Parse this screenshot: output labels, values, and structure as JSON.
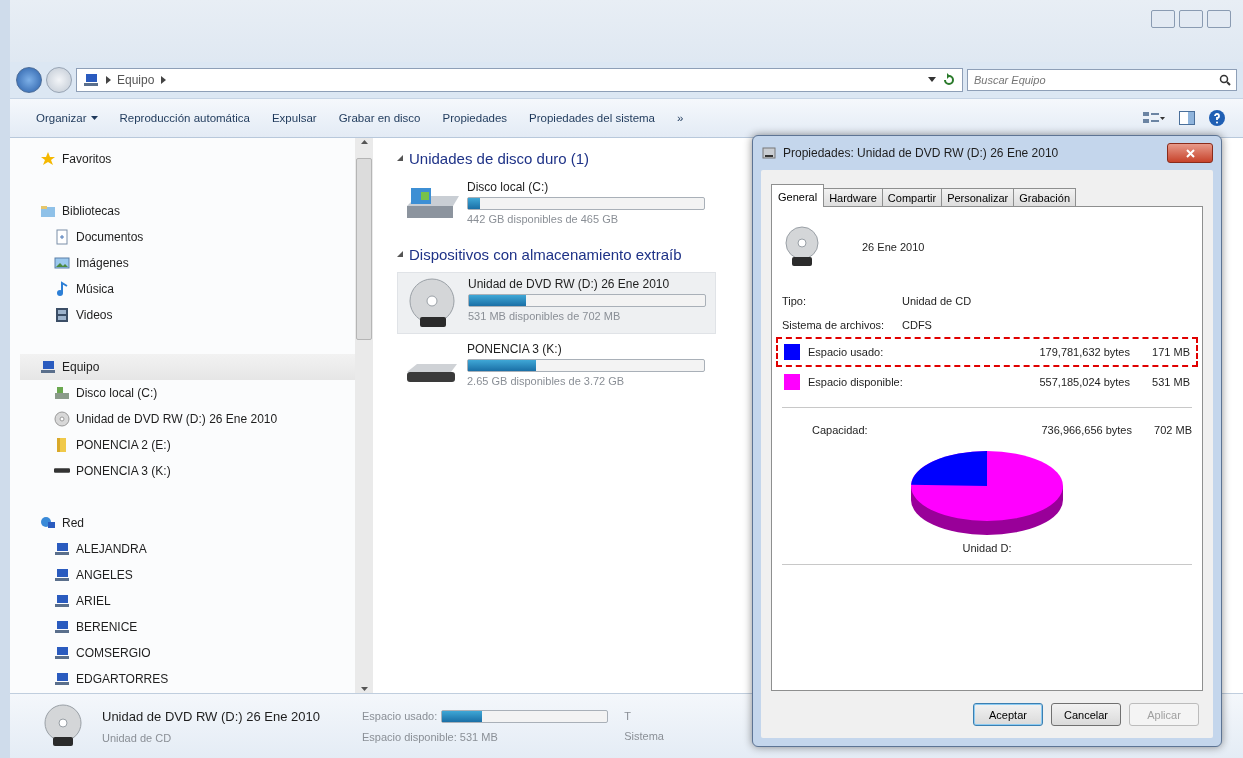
{
  "address_bar": {
    "breadcrumbs": [
      "Equipo"
    ]
  },
  "search": {
    "placeholder": "Buscar Equipo"
  },
  "toolbar": {
    "items": [
      {
        "label": "Organizar",
        "kind": "menu"
      },
      {
        "label": "Reproducción automática",
        "kind": "command"
      },
      {
        "label": "Expulsar",
        "kind": "command"
      },
      {
        "label": "Grabar en disco",
        "kind": "command"
      },
      {
        "label": "Propiedades",
        "kind": "command"
      },
      {
        "label": "Propiedades del sistema",
        "kind": "command"
      }
    ],
    "overflow": "»"
  },
  "sidebar": {
    "sections": [
      {
        "label": "Favoritos",
        "kind": "favorites",
        "selected": false
      },
      {
        "label": "Bibliotecas",
        "kind": "libraries",
        "selected": false,
        "children": [
          {
            "label": "Documentos",
            "kind": "documents",
            "selected": false
          },
          {
            "label": "Imágenes",
            "kind": "pictures",
            "selected": false
          },
          {
            "label": "Música",
            "kind": "music",
            "selected": false
          },
          {
            "label": "Videos",
            "kind": "videos",
            "selected": false
          }
        ]
      },
      {
        "label": "Equipo",
        "kind": "computer",
        "selected": true,
        "children": [
          {
            "label": "Disco local (C:)",
            "kind": "disk",
            "selected": false
          },
          {
            "label": "Unidad de DVD RW (D:) 26 Ene 2010",
            "kind": "dvd",
            "selected": false
          },
          {
            "label": "PONENCIA 2 (E:)",
            "kind": "folder",
            "selected": false
          },
          {
            "label": "PONENCIA 3 (K:)",
            "kind": "usb",
            "selected": false
          }
        ]
      },
      {
        "label": "Red",
        "kind": "network",
        "selected": false,
        "children": [
          {
            "label": "ALEJANDRA",
            "kind": "pc",
            "selected": false
          },
          {
            "label": "ANGELES",
            "kind": "pc",
            "selected": false
          },
          {
            "label": "ARIEL",
            "kind": "pc",
            "selected": false
          },
          {
            "label": "BERENICE",
            "kind": "pc",
            "selected": false
          },
          {
            "label": "COMSERGIO",
            "kind": "pc",
            "selected": false
          },
          {
            "label": "EDGARTORRES",
            "kind": "pc",
            "selected": false
          }
        ]
      }
    ]
  },
  "content": {
    "groups": [
      {
        "title": "Unidades de disco duro (1)",
        "drives": [
          {
            "name": "Disco local (C:)",
            "kind": "disk",
            "level": 0.05,
            "free": "442 GB disponibles de 465 GB",
            "selected": false
          }
        ]
      },
      {
        "title": "Dispositivos con almacenamiento extraíb",
        "drives": [
          {
            "name": "Unidad de DVD RW (D:) 26 Ene 2010",
            "kind": "dvd",
            "level": 0.24,
            "free": "531 MB disponibles de 702 MB",
            "selected": true
          },
          {
            "name": "PONENCIA 3 (K:)",
            "kind": "usb",
            "level": 0.29,
            "free": "2.65 GB disponibles de 3.72 GB",
            "selected": false
          }
        ]
      }
    ]
  },
  "details": {
    "name": "Unidad de DVD RW (D:) 26 Ene 2010",
    "type": "Unidad de CD",
    "used_label": "Espacio usado:",
    "level": 0.24,
    "free": "Espacio disponible: 531 MB",
    "column_3": "T",
    "column_4": "Sistema"
  },
  "dialog": {
    "title": "Propiedades: Unidad de DVD RW (D:) 26 Ene 2010",
    "tabs": [
      {
        "label": "General",
        "selected": true
      },
      {
        "label": "Hardware",
        "selected": false
      },
      {
        "label": "Compartir",
        "selected": false
      },
      {
        "label": "Personalizar",
        "selected": false
      },
      {
        "label": "Grabación",
        "selected": false
      }
    ],
    "disc_label": "26 Ene 2010",
    "fields": [
      {
        "label": "Tipo:",
        "value": "Unidad de CD"
      },
      {
        "label": "Sistema de archivos:",
        "value": "CDFS"
      }
    ],
    "usage": [
      {
        "label": "Espacio usado:",
        "bytes": "179,781,632 bytes",
        "size": "171 MB",
        "color": "#0000ff",
        "highlighted": true
      },
      {
        "label": "Espacio disponible:",
        "bytes": "557,185,024 bytes",
        "size": "531 MB",
        "color": "#ff00ff",
        "highlighted": false
      }
    ],
    "capacity": {
      "label": "Capacidad:",
      "bytes": "736,966,656 bytes",
      "size": "702 MB"
    },
    "chart": {
      "label": "Unidad D:"
    },
    "buttons": [
      {
        "label": "Aceptar",
        "disabled": false
      },
      {
        "label": "Cancelar",
        "disabled": false
      },
      {
        "label": "Aplicar",
        "disabled": true
      }
    ]
  }
}
